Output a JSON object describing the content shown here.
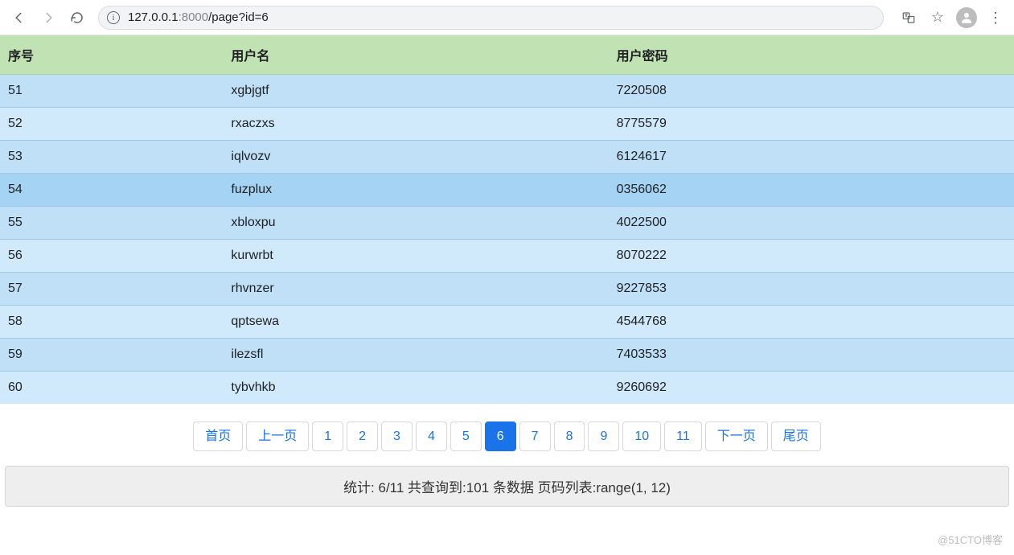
{
  "browser": {
    "url_host": "127.0.0.1",
    "url_port": ":8000",
    "url_path": "/page?id=6",
    "translate_icon": "translate-icon",
    "star_icon": "star-icon",
    "avatar_icon": "avatar-icon",
    "menu_icon": "kebab-icon"
  },
  "table": {
    "headers": {
      "id": "序号",
      "username": "用户名",
      "password": "用户密码"
    },
    "rows": [
      {
        "id": "51",
        "username": "xgbjgtf",
        "password": "7220508"
      },
      {
        "id": "52",
        "username": "rxaczxs",
        "password": "8775579"
      },
      {
        "id": "53",
        "username": "iqlvozv",
        "password": "6124617"
      },
      {
        "id": "54",
        "username": "fuzplux",
        "password": "0356062"
      },
      {
        "id": "55",
        "username": "xbloxpu",
        "password": "4022500"
      },
      {
        "id": "56",
        "username": "kurwrbt",
        "password": "8070222"
      },
      {
        "id": "57",
        "username": "rhvnzer",
        "password": "9227853"
      },
      {
        "id": "58",
        "username": "qptsewa",
        "password": "4544768"
      },
      {
        "id": "59",
        "username": "ilezsfl",
        "password": "7403533"
      },
      {
        "id": "60",
        "username": "tybvhkb",
        "password": "9260692"
      }
    ],
    "hover_index": 3
  },
  "pagination": {
    "first": "首页",
    "prev": "上一页",
    "pages": [
      "1",
      "2",
      "3",
      "4",
      "5",
      "6",
      "7",
      "8",
      "9",
      "10",
      "11"
    ],
    "active": "6",
    "next": "下一页",
    "last": "尾页"
  },
  "stats": {
    "text": "统计: 6/11 共查询到:101 条数据 页码列表:range(1, 12)"
  },
  "watermark": "@51CTO博客"
}
